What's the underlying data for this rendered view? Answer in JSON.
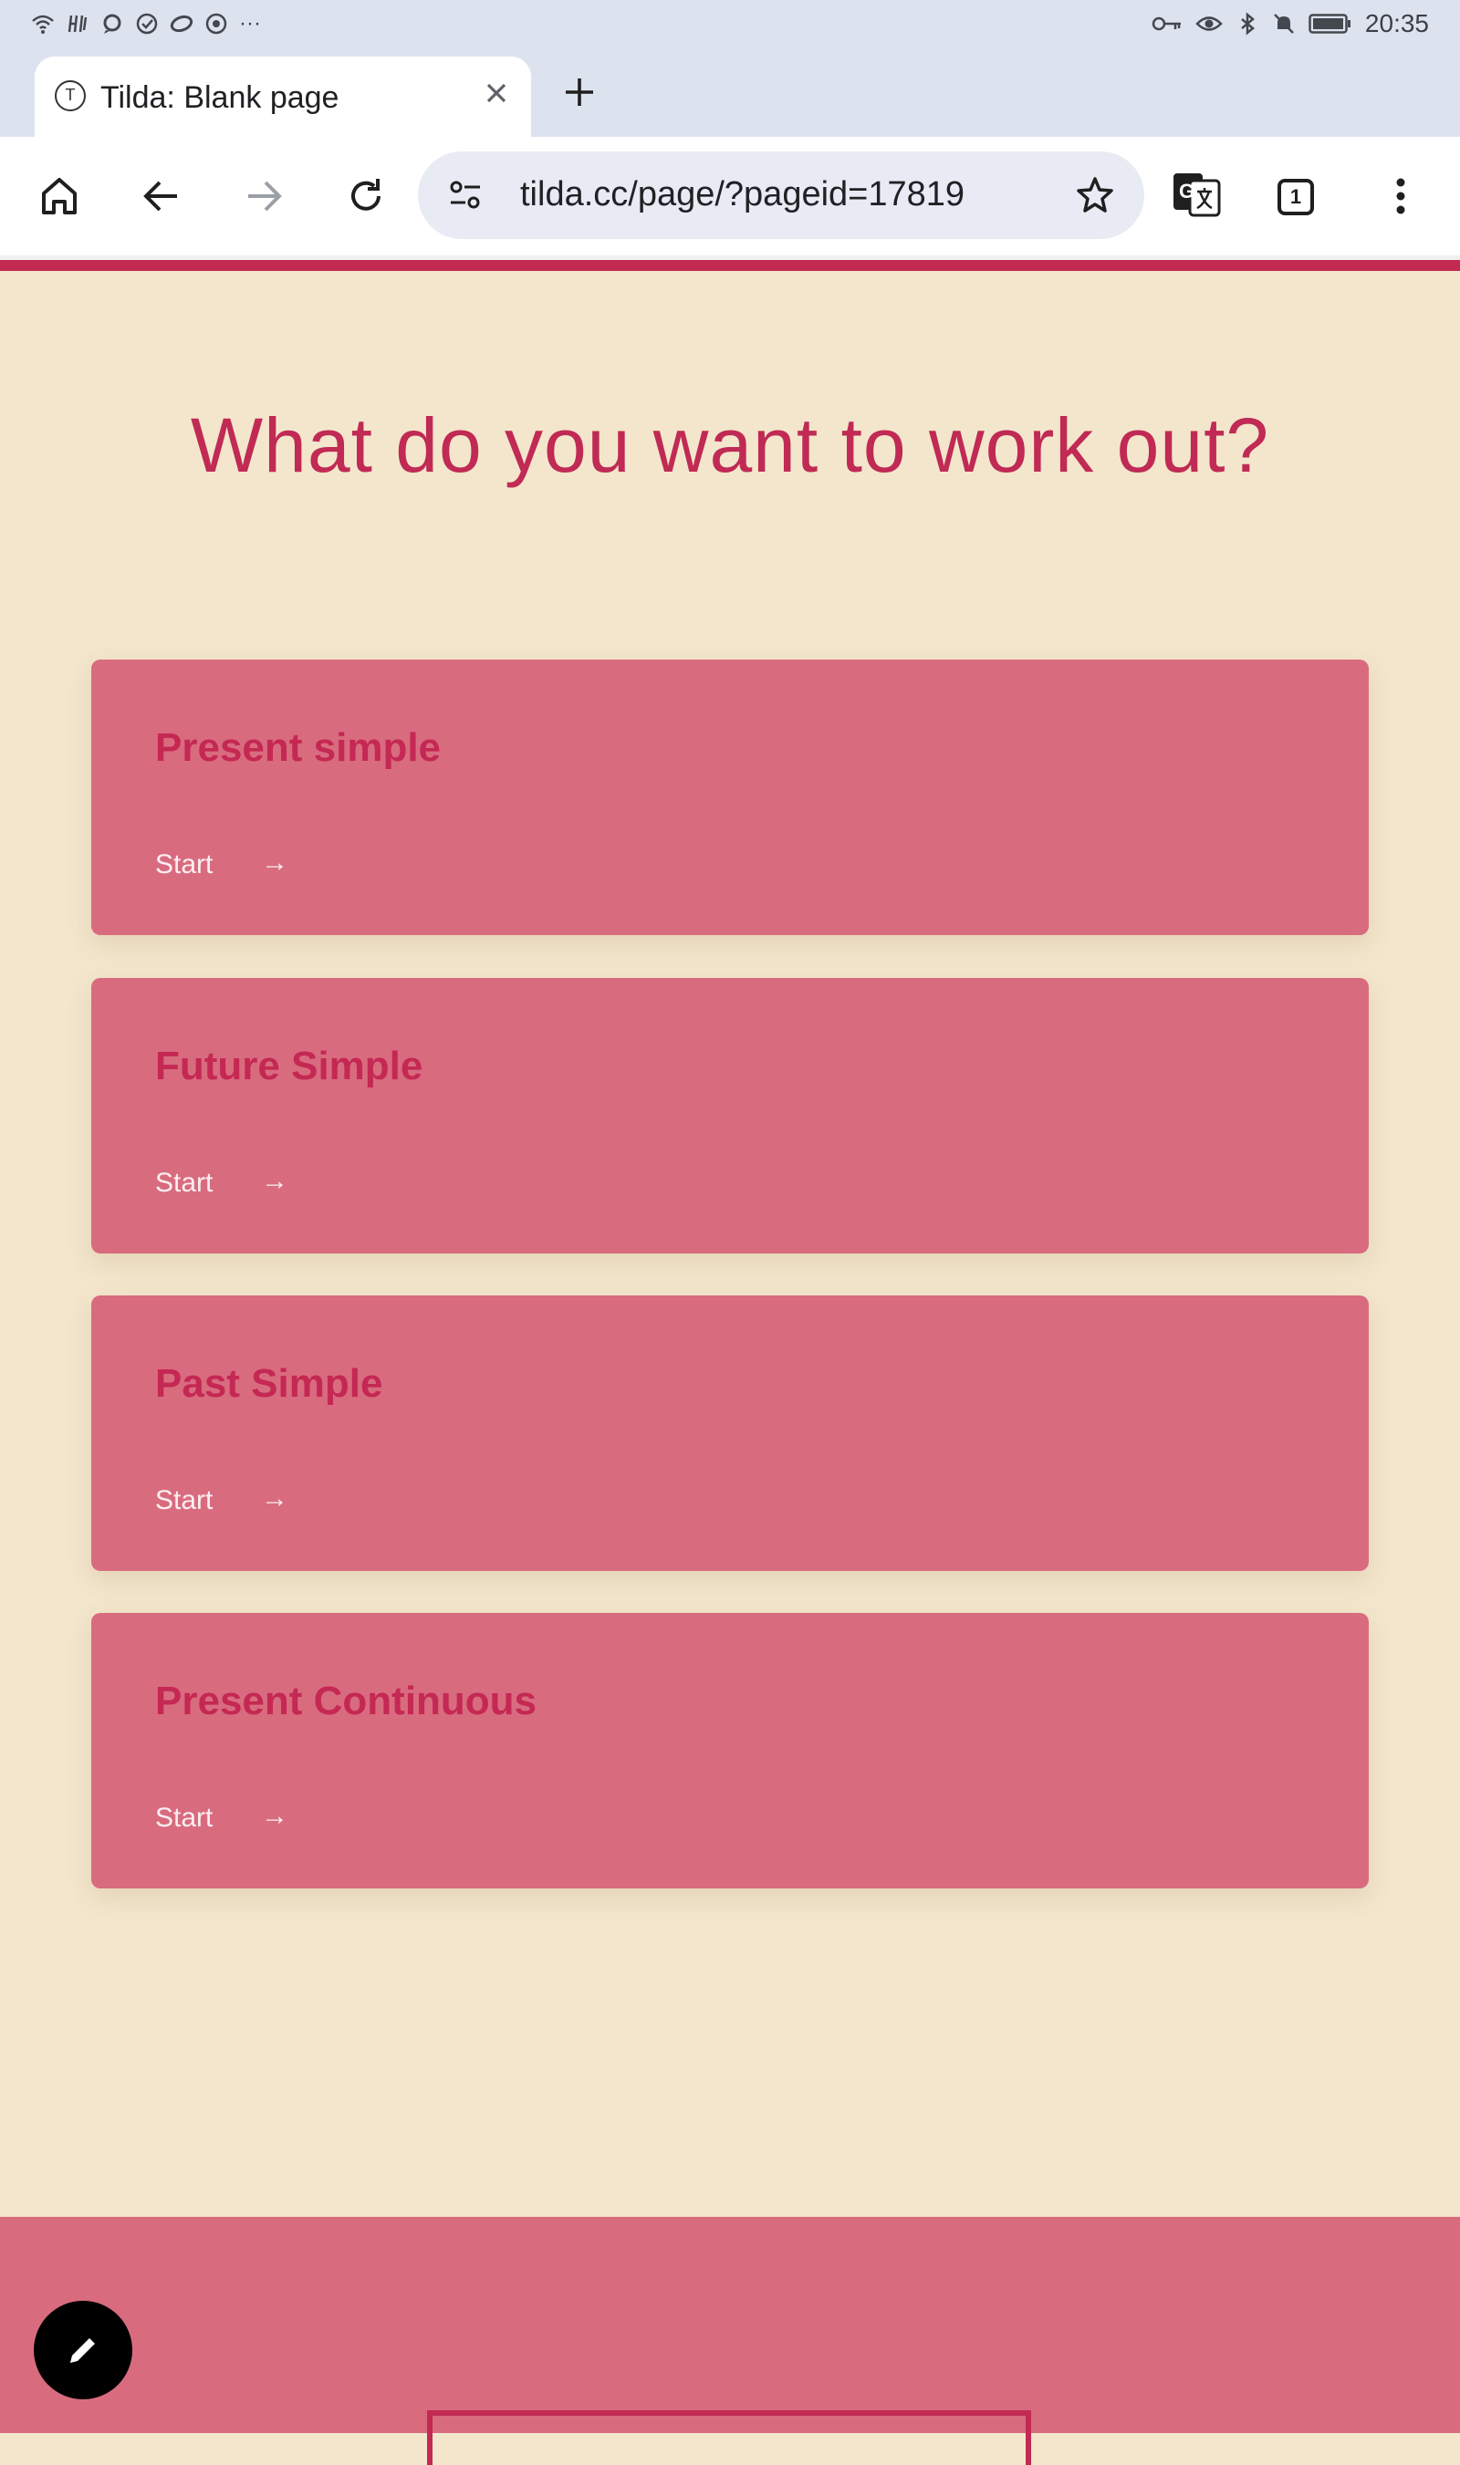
{
  "status_bar": {
    "time": "20:35",
    "left_icons": [
      "wifi-icon",
      "h-signal-icon",
      "notification-icon",
      "check-icon",
      "link-icon",
      "chrome-icon",
      "more-dots-icon"
    ],
    "right_icons": [
      "key-icon",
      "eye-icon",
      "bluetooth-icon",
      "mute-icon",
      "battery-icon"
    ],
    "more_label": "···"
  },
  "browser": {
    "tab_title": "Tilda: Blank page",
    "favicon_letter": "T",
    "url": "tilda.cc/page/?pageid=17819",
    "tab_count": "1"
  },
  "page": {
    "heading": "What do you want to work out?",
    "cards": [
      {
        "title": "Present simple",
        "action": "Start",
        "arrow": "→"
      },
      {
        "title": "Future Simple",
        "action": "Start",
        "arrow": "→"
      },
      {
        "title": "Past Simple",
        "action": "Start",
        "arrow": "→"
      },
      {
        "title": "Present Continuous",
        "action": "Start",
        "arrow": "→"
      }
    ]
  },
  "colors": {
    "page_background": "#f3e6cc",
    "accent": "#c22a52",
    "card_background": "#d96b7f",
    "card_text": "#fbeef0"
  }
}
